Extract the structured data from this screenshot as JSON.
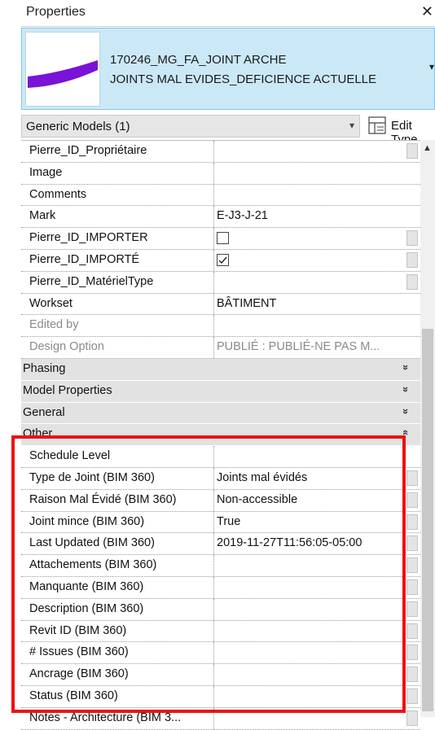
{
  "window": {
    "title": "Properties",
    "close_glyph": "✕"
  },
  "type_selector": {
    "line1": "170246_MG_FA_JOINT ARCHE",
    "line2": "JOINTS MAL EVIDES_DEFICIENCE ACTUELLE",
    "thumbnail_color": "#7a12d8",
    "dropdown_glyph": "▾"
  },
  "filter": {
    "value": "Generic Models (1)",
    "dropdown_glyph": "▾"
  },
  "edit_type": {
    "label": "Edit Type",
    "icon": "edit-type-icon"
  },
  "rows": [
    {
      "kind": "param",
      "name": "Pierre_ID_Propriétaire",
      "value": "",
      "button": true
    },
    {
      "kind": "param",
      "name": "Image",
      "value": ""
    },
    {
      "kind": "param",
      "name": "Comments",
      "value": ""
    },
    {
      "kind": "param",
      "name": "Mark",
      "value": "E-J3-J-21"
    },
    {
      "kind": "param",
      "name": "Pierre_ID_IMPORTER",
      "checkbox": false,
      "button": true
    },
    {
      "kind": "param",
      "name": "Pierre_ID_IMPORTÉ",
      "checkbox": true,
      "button": true
    },
    {
      "kind": "param",
      "name": "Pierre_ID_MatérielType",
      "value": "",
      "button": true
    },
    {
      "kind": "param",
      "name": "Workset",
      "value": "BÂTIMENT"
    },
    {
      "kind": "param",
      "name": "Edited by",
      "value": "",
      "disabled": true
    },
    {
      "kind": "param",
      "name": "Design Option",
      "value": "PUBLIÉ : PUBLIÉ-NE PAS M...",
      "disabled": true
    },
    {
      "kind": "group",
      "name": "Phasing",
      "chevron": "»"
    },
    {
      "kind": "group",
      "name": "Model Properties",
      "chevron": "»"
    },
    {
      "kind": "group",
      "name": "General",
      "chevron": "»"
    },
    {
      "kind": "group",
      "name": "Other",
      "chevron": "«"
    },
    {
      "kind": "param",
      "name": "Schedule Level",
      "value": ""
    },
    {
      "kind": "param",
      "name": "Type de Joint (BIM 360)",
      "value": "Joints mal évidés",
      "button": true
    },
    {
      "kind": "param",
      "name": "Raison Mal Évidé (BIM 360)",
      "value": "Non-accessible",
      "button": true
    },
    {
      "kind": "param",
      "name": "Joint mince (BIM 360)",
      "value": "True",
      "button": true
    },
    {
      "kind": "param",
      "name": "Last Updated (BIM 360)",
      "value": "2019-11-27T11:56:05-05:00",
      "button": true
    },
    {
      "kind": "param",
      "name": "Attachements (BIM 360)",
      "value": "",
      "button": true
    },
    {
      "kind": "param",
      "name": "Manquante (BIM 360)",
      "value": "",
      "button": true
    },
    {
      "kind": "param",
      "name": "Description (BIM 360)",
      "value": "",
      "button": true
    },
    {
      "kind": "param",
      "name": "Revit ID (BIM 360)",
      "value": "",
      "button": true
    },
    {
      "kind": "param",
      "name": "# Issues (BIM 360)",
      "value": "",
      "button": true
    },
    {
      "kind": "param",
      "name": "Ancrage (BIM 360)",
      "value": "",
      "button": true
    },
    {
      "kind": "param",
      "name": "Status (BIM 360)",
      "value": "",
      "button": true
    },
    {
      "kind": "param",
      "name": "Notes - Architecture (BIM 3...",
      "value": "",
      "button": true
    }
  ],
  "highlight_color": "#ee1111"
}
